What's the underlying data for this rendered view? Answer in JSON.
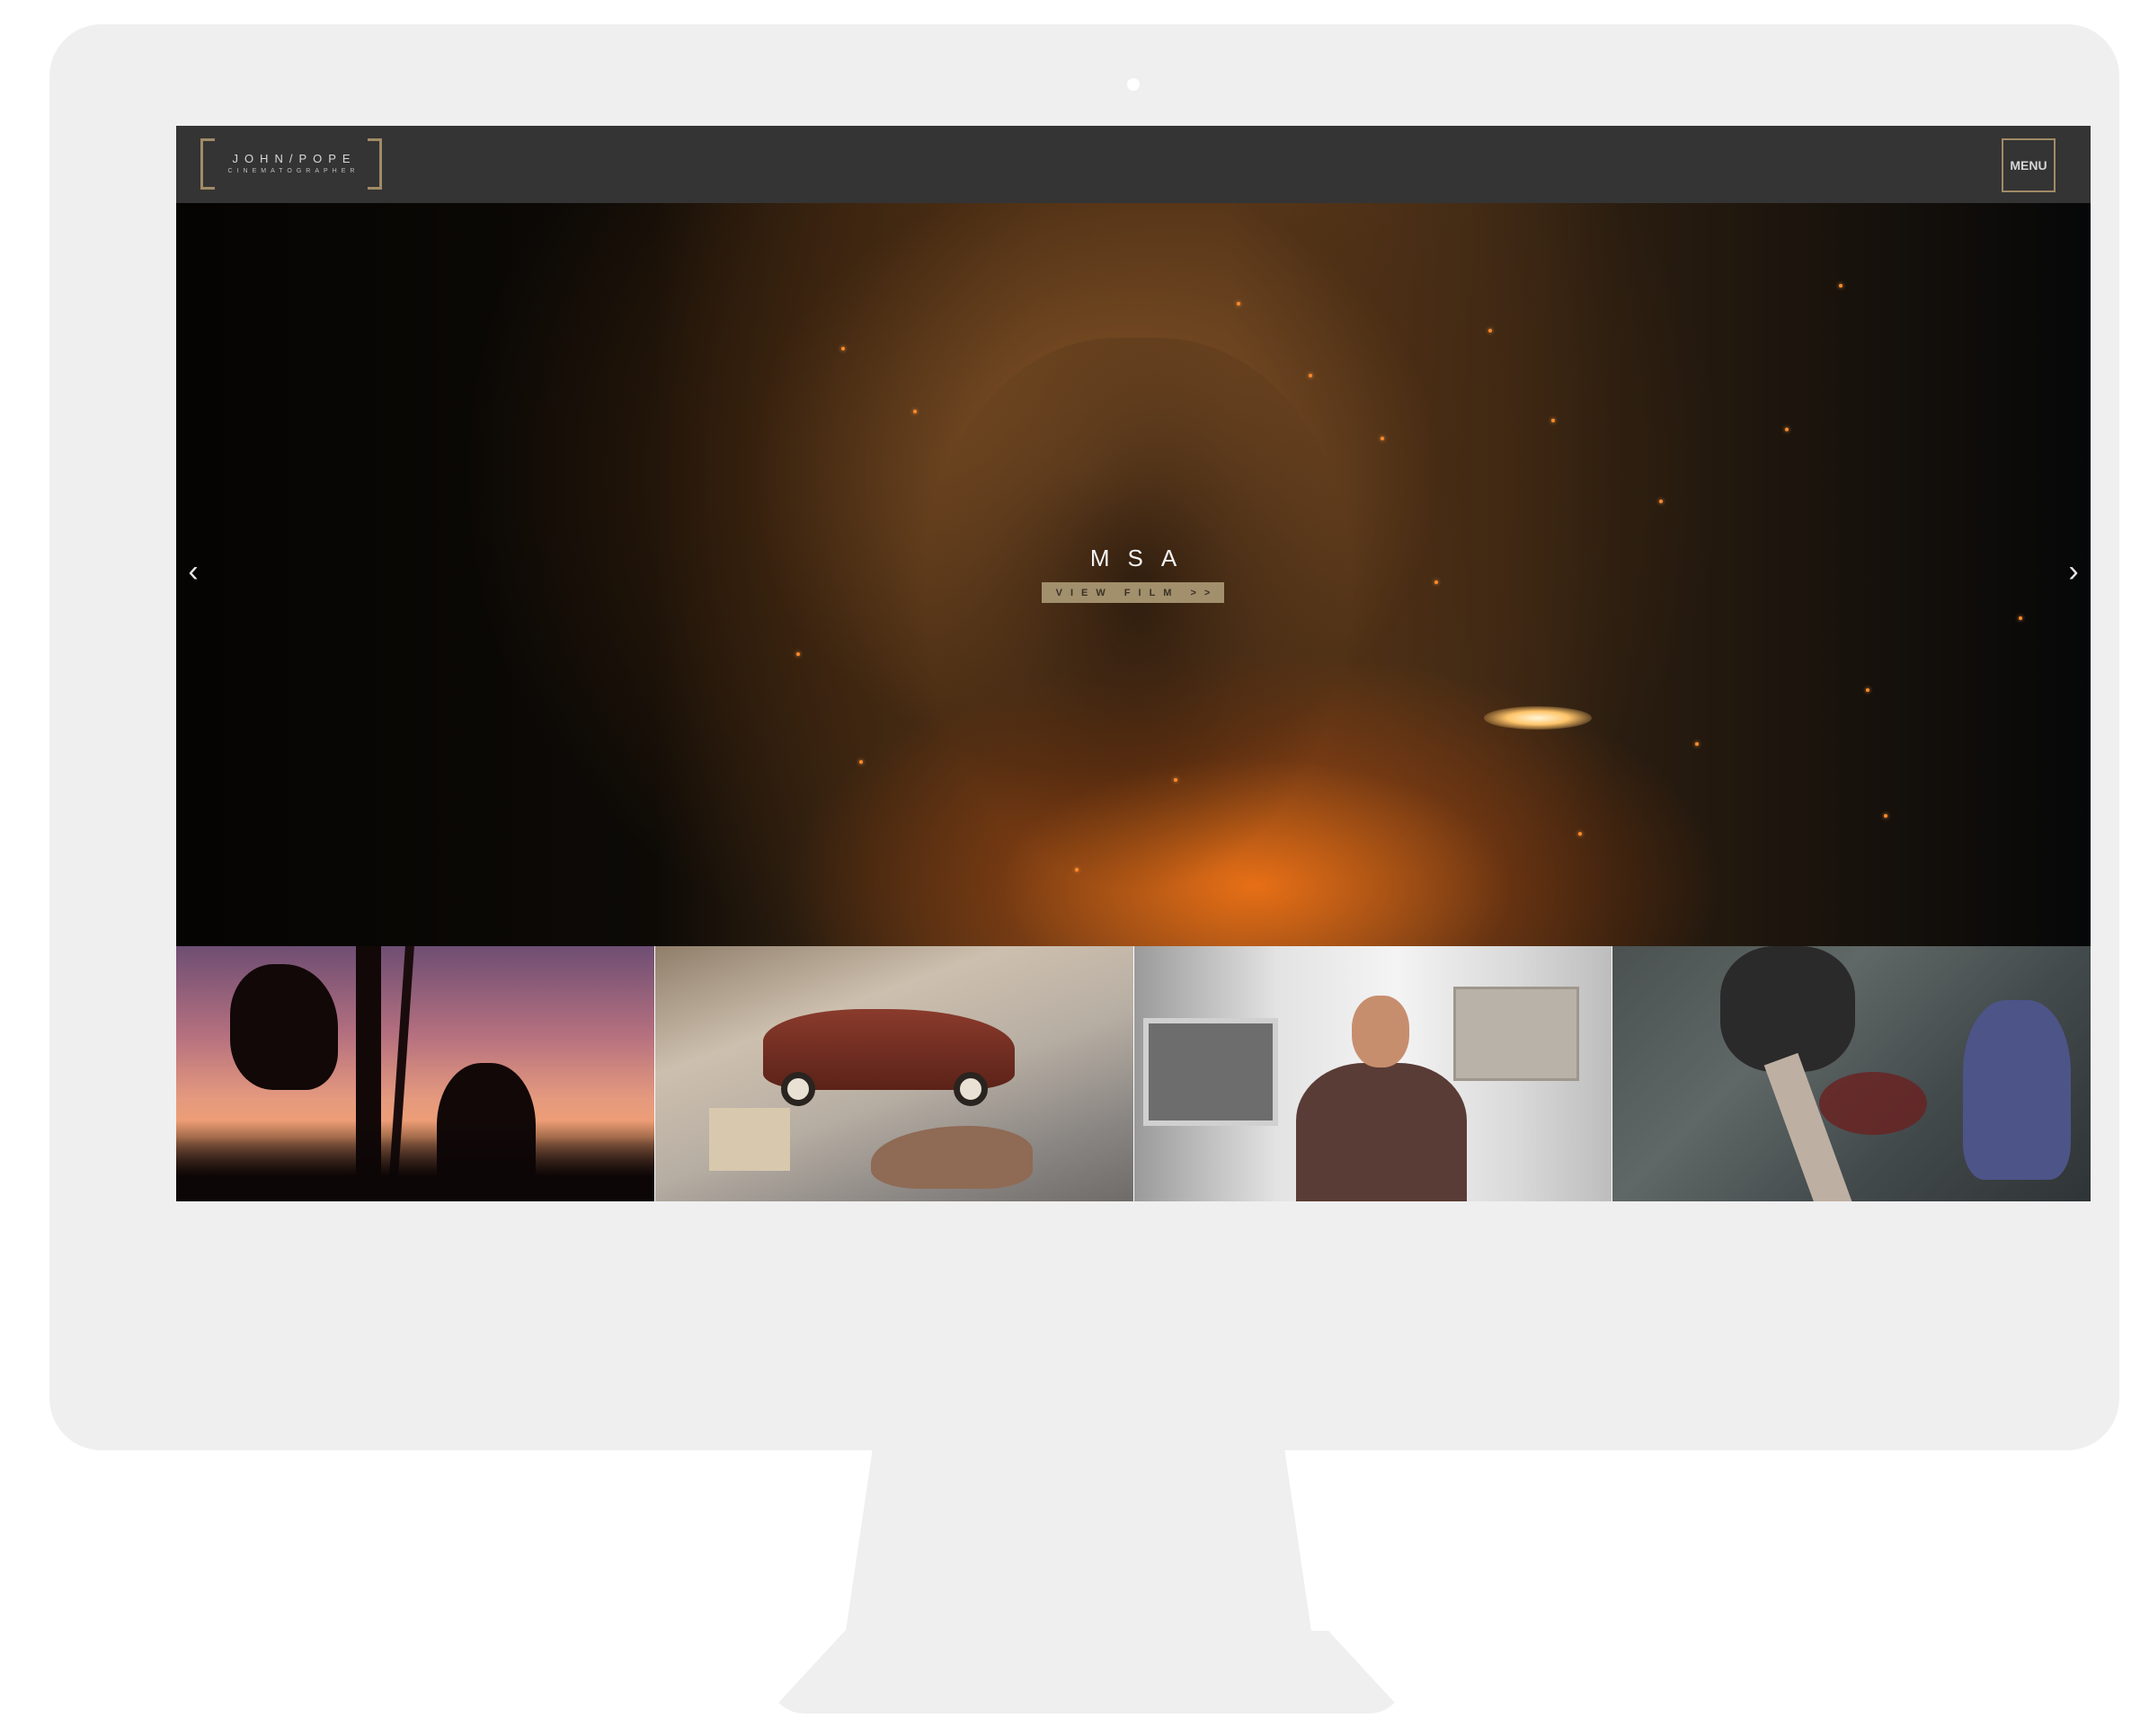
{
  "header": {
    "logo_name": "JOHN/POPE",
    "logo_subtitle": "CINEMATOGRAPHER",
    "menu_label": "MENU"
  },
  "hero": {
    "title": "MSA",
    "cta_label": "VIEW FILM >>",
    "prev_arrow": "‹",
    "next_arrow": "›"
  },
  "thumbnails": [
    {
      "name": "thumbnail-silhouette-climbers"
    },
    {
      "name": "thumbnail-model-car-workbench"
    },
    {
      "name": "thumbnail-portrait-studio"
    },
    {
      "name": "thumbnail-overhead-street-scene"
    }
  ],
  "colors": {
    "header_bg": "#343434",
    "accent_gold": "#a18b66",
    "cta_bg": "#a28f6c",
    "bezel": "#efefef"
  }
}
